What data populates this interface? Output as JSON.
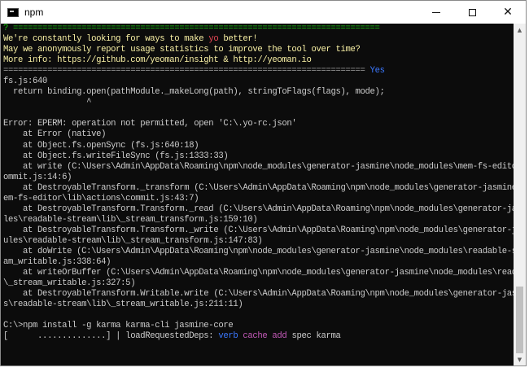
{
  "window": {
    "title": "npm",
    "controls": {
      "minimize": "minimize",
      "maximize": "maximize",
      "close": "✕"
    }
  },
  "terminal": {
    "lines": [
      {
        "segments": [
          {
            "text": "? ===========================================================================",
            "color": "green"
          }
        ]
      },
      {
        "segments": [
          {
            "text": "We're constantly looking for ways to make ",
            "color": "y"
          },
          {
            "text": "yo",
            "color": "red"
          },
          {
            "text": " better!",
            "color": "y"
          }
        ]
      },
      {
        "segments": [
          {
            "text": "May we anonymously report usage statistics to improve the tool over time?",
            "color": "y"
          }
        ]
      },
      {
        "segments": [
          {
            "text": "More info: https://github.com/yeoman/insight & http://yeoman.io",
            "color": "y"
          }
        ]
      },
      {
        "segments": [
          {
            "text": "========================================================================== ",
            "color": "grey"
          },
          {
            "text": "Yes",
            "color": "blue"
          }
        ]
      },
      {
        "segments": [
          {
            "text": "fs.js:640",
            "color": "default"
          }
        ]
      },
      {
        "segments": [
          {
            "text": "  return binding.open(pathModule._makeLong(path), stringToFlags(flags), mode);",
            "color": "default"
          }
        ]
      },
      {
        "segments": [
          {
            "text": "                 ^",
            "color": "default"
          }
        ]
      },
      {
        "segments": [
          {
            "text": "",
            "color": "default"
          }
        ]
      },
      {
        "segments": [
          {
            "text": "Error: EPERM: operation not permitted, open 'C:\\.yo-rc.json'",
            "color": "default"
          }
        ]
      },
      {
        "segments": [
          {
            "text": "    at Error (native)",
            "color": "default"
          }
        ]
      },
      {
        "segments": [
          {
            "text": "    at Object.fs.openSync (fs.js:640:18)",
            "color": "default"
          }
        ]
      },
      {
        "segments": [
          {
            "text": "    at Object.fs.writeFileSync (fs.js:1333:33)",
            "color": "default"
          }
        ]
      },
      {
        "segments": [
          {
            "text": "    at write (C:\\Users\\Admin\\AppData\\Roaming\\npm\\node_modules\\generator-jasmine\\node_modules\\mem-fs-editor\\lib\\actions\\c",
            "color": "default"
          }
        ]
      },
      {
        "segments": [
          {
            "text": "ommit.js:14:6)",
            "color": "default"
          }
        ]
      },
      {
        "segments": [
          {
            "text": "    at DestroyableTransform._transform (C:\\Users\\Admin\\AppData\\Roaming\\npm\\node_modules\\generator-jasmine\\node_modules\\m",
            "color": "default"
          }
        ]
      },
      {
        "segments": [
          {
            "text": "em-fs-editor\\lib\\actions\\commit.js:43:7)",
            "color": "default"
          }
        ]
      },
      {
        "segments": [
          {
            "text": "    at DestroyableTransform.Transform._read (C:\\Users\\Admin\\AppData\\Roaming\\npm\\node_modules\\generator-jasmine\\node_modules",
            "color": "default"
          }
        ]
      },
      {
        "segments": [
          {
            "text": "les\\readable-stream\\lib\\_stream_transform.js:159:10)",
            "color": "default"
          }
        ]
      },
      {
        "segments": [
          {
            "text": "    at DestroyableTransform.Transform._write (C:\\Users\\Admin\\AppData\\Roaming\\npm\\node_modules\\generator-jasmine\\node_modu",
            "color": "default"
          }
        ]
      },
      {
        "segments": [
          {
            "text": "ules\\readable-stream\\lib\\_stream_transform.js:147:83)",
            "color": "default"
          }
        ]
      },
      {
        "segments": [
          {
            "text": "    at doWrite (C:\\Users\\Admin\\AppData\\Roaming\\npm\\node_modules\\generator-jasmine\\node_modules\\readable-stream\\lib\\_strea",
            "color": "default"
          }
        ]
      },
      {
        "segments": [
          {
            "text": "am_writable.js:338:64)",
            "color": "default"
          }
        ]
      },
      {
        "segments": [
          {
            "text": "    at writeOrBuffer (C:\\Users\\Admin\\AppData\\Roaming\\npm\\node_modules\\generator-jasmine\\node_modules\\readable-stream\\lib",
            "color": "default"
          }
        ]
      },
      {
        "segments": [
          {
            "text": "\\_stream_writable.js:327:5)",
            "color": "default"
          }
        ]
      },
      {
        "segments": [
          {
            "text": "    at DestroyableTransform.Writable.write (C:\\Users\\Admin\\AppData\\Roaming\\npm\\node_modules\\generator-jasmine\\node_modules",
            "color": "default"
          }
        ]
      },
      {
        "segments": [
          {
            "text": "s\\readable-stream\\lib\\_stream_writable.js:211:11)",
            "color": "default"
          }
        ]
      },
      {
        "segments": [
          {
            "text": "",
            "color": "default"
          }
        ]
      },
      {
        "segments": [
          {
            "text": "C:\\>npm install -g karma karma-cli jasmine-core",
            "color": "default"
          }
        ]
      },
      {
        "segments": [
          {
            "text": "[      ..............] | loadRequestedDeps: ",
            "color": "default"
          },
          {
            "text": "verb",
            "color": "blue"
          },
          {
            "text": " ",
            "color": "default"
          },
          {
            "text": "cache add",
            "color": "pink"
          },
          {
            "text": " spec karma",
            "color": "default"
          }
        ]
      }
    ]
  },
  "colors": {
    "default": "#cccccc",
    "y": "#f9f1a5",
    "red": "#e74856",
    "grey": "#a0a0a0",
    "green": "#16c60c",
    "blue": "#3b78ff",
    "pink": "#c55ab9",
    "background": "#0c0c0c"
  },
  "scrollbar": {
    "up_icon": "chevron-up-icon",
    "down_icon": "chevron-down-icon"
  }
}
